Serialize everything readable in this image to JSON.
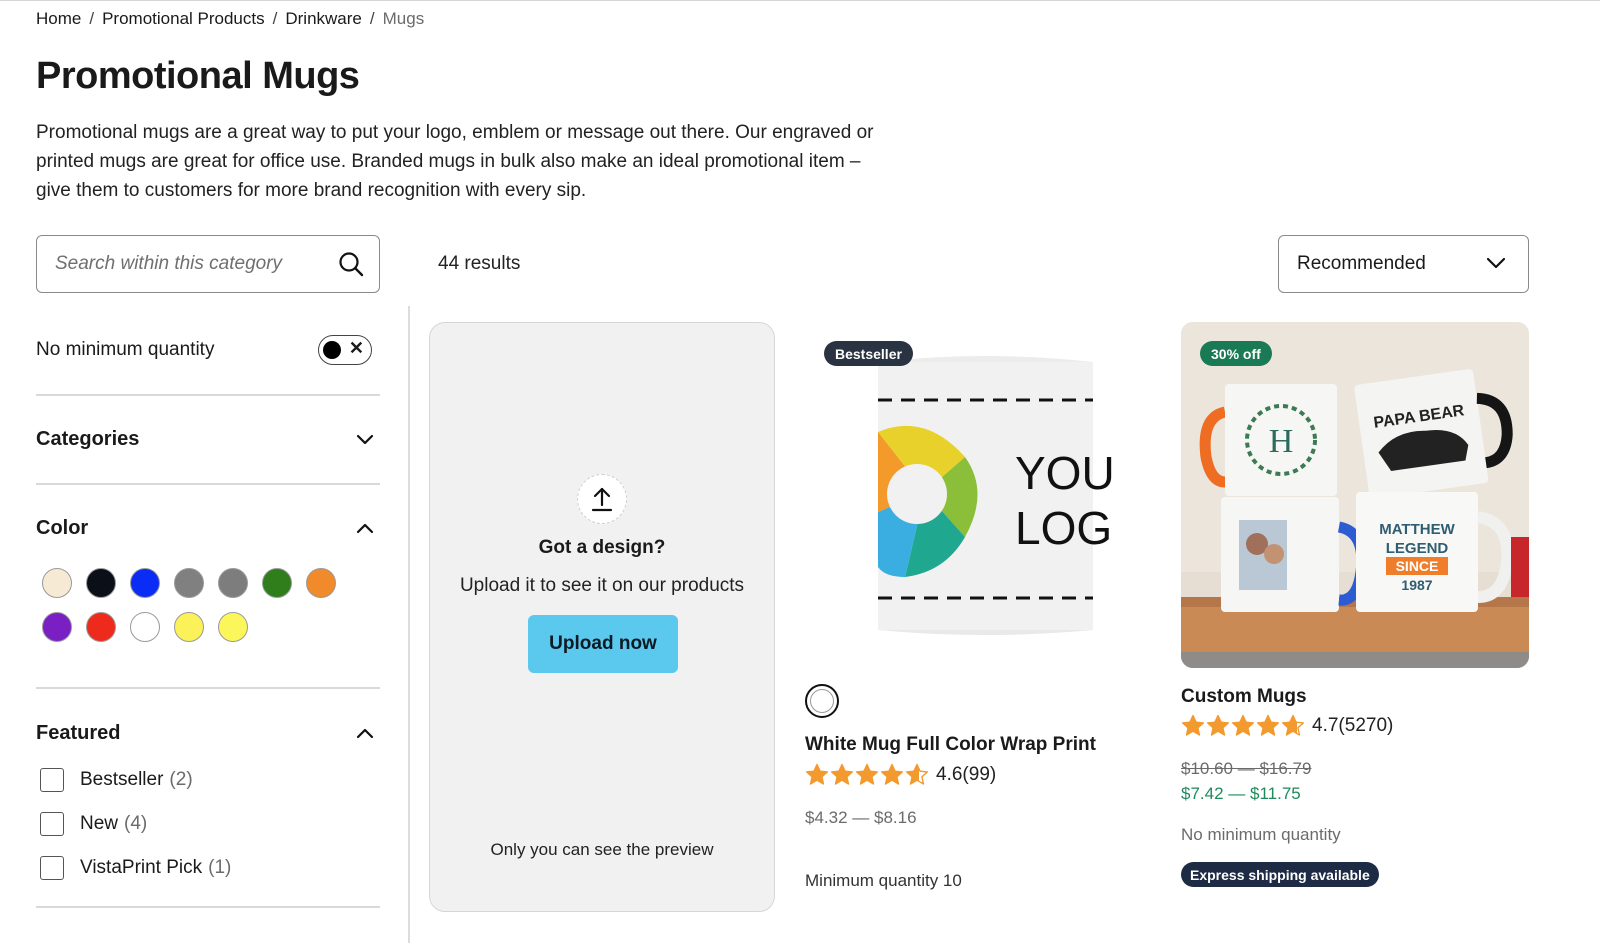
{
  "breadcrumb": {
    "items": [
      "Home",
      "Promotional Products",
      "Drinkware"
    ],
    "current": "Mugs",
    "separator": "/"
  },
  "page": {
    "title": "Promotional Mugs",
    "description": "Promotional mugs are a great way to put your logo, emblem or message out there. Our engraved or printed mugs are great for office use. Branded mugs in bulk also make an ideal promotional item – give them to customers for more brand recognition with every sip."
  },
  "search": {
    "placeholder": "Search within this category",
    "icon": "search-icon"
  },
  "results": {
    "count_label": "44 results"
  },
  "sort": {
    "selected": "Recommended",
    "icon": "chevron-down-icon"
  },
  "filters": {
    "min_qty": {
      "label": "No minimum quantity",
      "toggle_state": "off"
    },
    "categories": {
      "label": "Categories",
      "expanded": false
    },
    "color": {
      "label": "Color",
      "expanded": true,
      "swatches": [
        "#f7ead5",
        "#0b0f17",
        "#0b2cf5",
        "#808080",
        "#7d7d7d",
        "#2f7d1b",
        "#f08a2a",
        "#7a1fc4",
        "#ee2a1d",
        "#ffffff",
        "#fbf25a",
        "#fbf75b"
      ]
    },
    "featured": {
      "label": "Featured",
      "expanded": true,
      "options": [
        {
          "label": "Bestseller",
          "count": "(2)"
        },
        {
          "label": "New",
          "count": "(4)"
        },
        {
          "label": "VistaPrint Pick",
          "count": "(1)"
        }
      ]
    }
  },
  "upload_card": {
    "title": "Got a design?",
    "subtitle": "Upload it to see it on our products",
    "button": "Upload now",
    "note": "Only you can see the preview"
  },
  "products": [
    {
      "badge": "Bestseller",
      "name": "White Mug Full Color Wrap Print",
      "rating": "4.6",
      "reviews": "(99)",
      "stars_filled": 4.6,
      "price": "$4.32 — $8.16",
      "meta": "Minimum quantity 10",
      "mug_text_line1": "YOU",
      "mug_text_line2": "LOG"
    },
    {
      "badge": "30% off",
      "name": "Custom Mugs",
      "rating": "4.7",
      "reviews": "(5270)",
      "stars_filled": 4.7,
      "old_price": "$10.60 — $16.79",
      "sale_price": "$7.42 — $11.75",
      "meta": "No minimum quantity",
      "express": "Express shipping available",
      "mug_letter": "H",
      "mug_papa": "PAPA BEAR",
      "mug_matthew": "MATTHEW",
      "mug_legend": "LEGEND",
      "mug_since": "SINCE",
      "mug_year": "1987"
    }
  ],
  "colors": {
    "star": "#f29a2e",
    "upload_button": "#5bc8ee",
    "sale_green": "#1f8a5b",
    "bestseller_badge": "#2a3342",
    "sale_badge": "#197a55"
  }
}
